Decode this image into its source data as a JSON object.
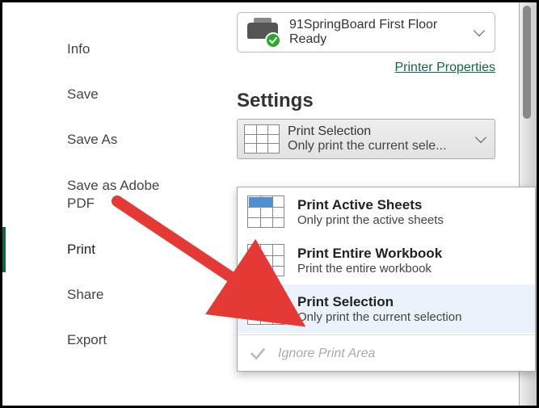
{
  "sidebar": {
    "items": [
      {
        "label": "Info"
      },
      {
        "label": "Save"
      },
      {
        "label": "Save As"
      },
      {
        "label": "Save as Adobe PDF"
      },
      {
        "label": "Print"
      },
      {
        "label": "Share"
      },
      {
        "label": "Export"
      }
    ]
  },
  "printer": {
    "name": "91SpringBoard First Floor",
    "status": "Ready",
    "properties_link": "Printer Properties"
  },
  "settings": {
    "heading": "Settings",
    "selected_title": "Print Selection",
    "selected_sub": "Only print the current sele...",
    "options": [
      {
        "title": "Print Active Sheets",
        "sub": "Only print the active sheets"
      },
      {
        "title": "Print Entire Workbook",
        "sub": "Print the entire workbook"
      },
      {
        "title": "Print Selection",
        "sub": "Only print the current selection"
      }
    ],
    "ignore_label": "Ignore Print Area"
  }
}
